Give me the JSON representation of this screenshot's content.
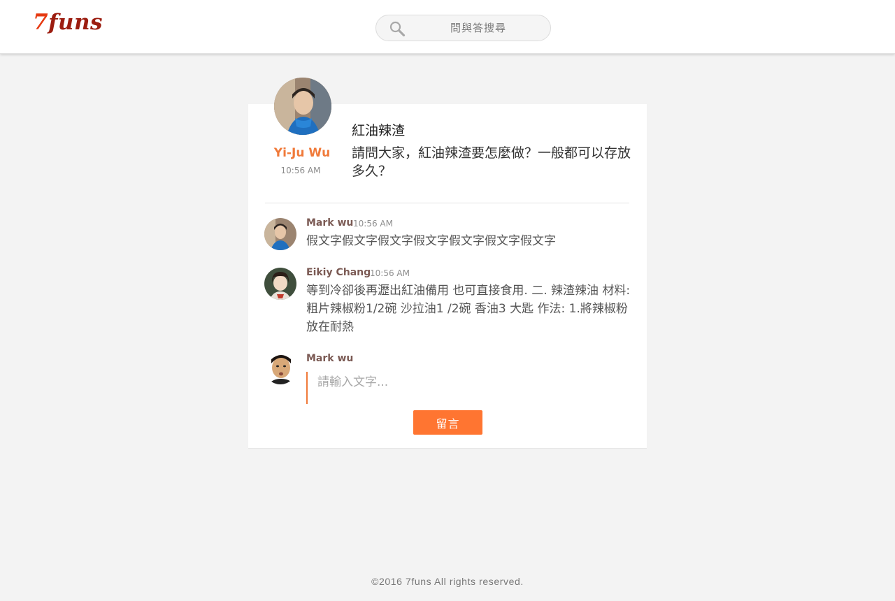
{
  "header": {
    "logo_seven": "7",
    "logo_rest": "funs",
    "search_placeholder": "問與答搜尋"
  },
  "question": {
    "author_name": "Yi-Ju Wu",
    "author_time": "10:56 AM",
    "title": "紅油辣渣",
    "body": "請問大家，紅油辣渣要怎麼做？一般都可以存放多久？"
  },
  "comments": [
    {
      "name": "Mark wu",
      "time": "10:56 AM",
      "text": "假文字假文字假文字假文字假文字假文字假文字"
    },
    {
      "name": "Eikiy Chang",
      "time": "10:56 AM",
      "text": "等到冷卻後再瀝出紅油備用 也可直接食用. 二. 辣渣辣油 材料: 粗片辣椒粉1/2碗 沙拉油1 /2碗 香油3 大匙 作法: 1.將辣椒粉放在耐熱"
    }
  ],
  "reply": {
    "name": "Mark wu",
    "placeholder": "請輸入文字...",
    "submit_label": "留言"
  },
  "footer": {
    "copyright": "©2016 7funs All rights reserved."
  },
  "colors": {
    "accent": "#ff7531",
    "author_name": "#f07a3a",
    "commenter_name": "#7b5a54",
    "logo_red": "#e63a12",
    "logo_dark": "#9c1d10"
  }
}
